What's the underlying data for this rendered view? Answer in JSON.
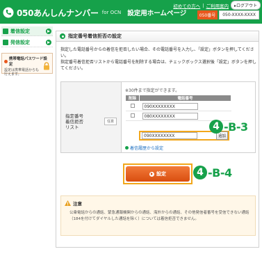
{
  "header": {
    "service_name": "050あんしんナンバー",
    "for_ocn": "for OCN",
    "page_name": "設定用ホームページ",
    "help_link": "初めての方へ",
    "contact_link": "ご利用案内",
    "logout": "ログアウト",
    "number_label": "050番号",
    "number_value": "050-XXXX-XXXX"
  },
  "sidebar": {
    "items": [
      {
        "label": "着信設定"
      },
      {
        "label": "発信設定"
      }
    ],
    "password_box": {
      "title": "携帯電話パスワード設定",
      "desc": "設定は携帯電話からも行えます。"
    }
  },
  "main": {
    "section_title": "指定番号着信拒否の設定",
    "desc_lines": [
      "指定した電話番号からの着信を拒否したい場合、その電話番号を入力し、「設定」ボタンを押してください。",
      "指定番号着信拒否リストから電話番号を削除する場合は、チェックボックス選択後「設定」ボタンを押してください。"
    ],
    "settings": {
      "label": "指定番号\n着信拒否\nリスト",
      "optional_badge": "任意",
      "max_note": "※30件まで指定ができます。",
      "col_delete": "削除",
      "col_number": "電話番号",
      "rows": [
        {
          "number": "090XXXXXXXX"
        },
        {
          "number": "080XXXXXXXX"
        }
      ],
      "new_number": "090XXXXXXXX",
      "add_button": "追加",
      "history_link": "着信履歴から設定"
    },
    "submit_button": "設定",
    "step_b3_num": "4",
    "step_b3_text": "-B-3",
    "step_b4_num": "4",
    "step_b4_text": "-B-4",
    "notice": {
      "title": "注意",
      "text": "公衆電話からの通話、緊急通報機関からの通話、海外からの通話、その他発信者番号を受信できない通話（184を付けてダイヤルした通話を除く）については着信拒否できません。"
    }
  },
  "colors": {
    "brand_green": "#16a14a",
    "accent_orange": "#e8571c",
    "highlight_yellow": "#f2a71b"
  }
}
